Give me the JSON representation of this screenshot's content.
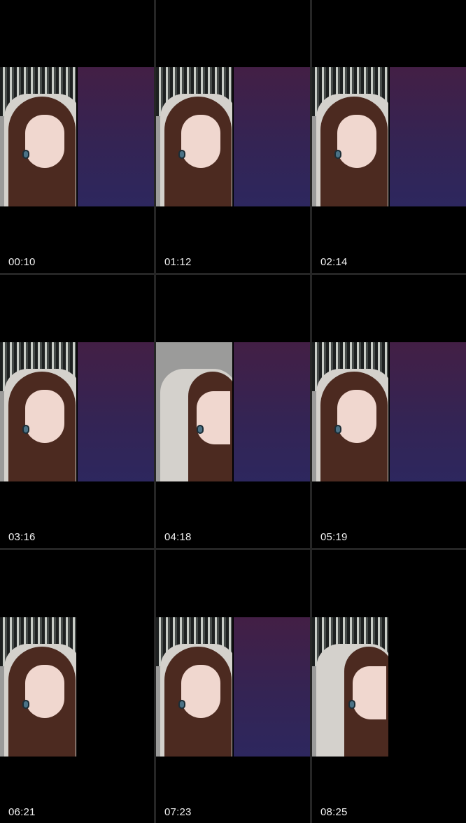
{
  "thumbnails": [
    {
      "timestamp": "00:10",
      "side_panel": "purple"
    },
    {
      "timestamp": "01:12",
      "side_panel": "purple"
    },
    {
      "timestamp": "02:14",
      "side_panel": "purple"
    },
    {
      "timestamp": "03:16",
      "side_panel": "purple"
    },
    {
      "timestamp": "04:18",
      "side_panel": "purple"
    },
    {
      "timestamp": "05:19",
      "side_panel": "purple"
    },
    {
      "timestamp": "06:21",
      "side_panel": "none"
    },
    {
      "timestamp": "07:23",
      "side_panel": "purple"
    },
    {
      "timestamp": "08:25",
      "side_panel": "none"
    }
  ],
  "colors": {
    "background": "#000000",
    "divider": "#262626",
    "timestamp_text": "#f0f0f0",
    "side_panel_top": "#431f45",
    "side_panel_bottom": "#2d275e"
  }
}
